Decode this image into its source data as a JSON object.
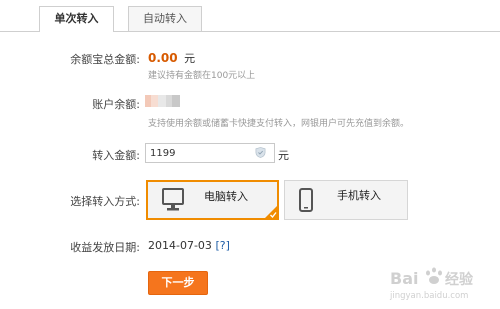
{
  "tabs": [
    {
      "label": "单次转入",
      "active": true
    },
    {
      "label": "自动转入",
      "active": false
    }
  ],
  "total": {
    "label": "余额宝总金额:",
    "amount": "0.00",
    "unit": "元",
    "hint": "建议持有金额在100元以上"
  },
  "balance": {
    "label": "账户余额:",
    "hint": "支持使用余额或储蓄卡快捷支付转入，网银用户可先充值到余额。"
  },
  "transfer": {
    "label": "转入金额:",
    "value": "1199",
    "unit": "元"
  },
  "method": {
    "label": "选择转入方式:",
    "options": [
      {
        "label": "电脑转入",
        "icon": "monitor-icon",
        "selected": true
      },
      {
        "label": "手机转入",
        "icon": "phone-icon",
        "selected": false
      }
    ]
  },
  "payout": {
    "label": "收益发放日期:",
    "date": "2014-07-03",
    "help": "[?]"
  },
  "next_button": "下一步",
  "watermark": {
    "brand": "Baidu经验",
    "url": "jingyan.baidu.com"
  },
  "colors": {
    "accent": "#f5751d",
    "amount": "#d75a00",
    "selected_border": "#f08c00",
    "link": "#1f5fa8"
  }
}
